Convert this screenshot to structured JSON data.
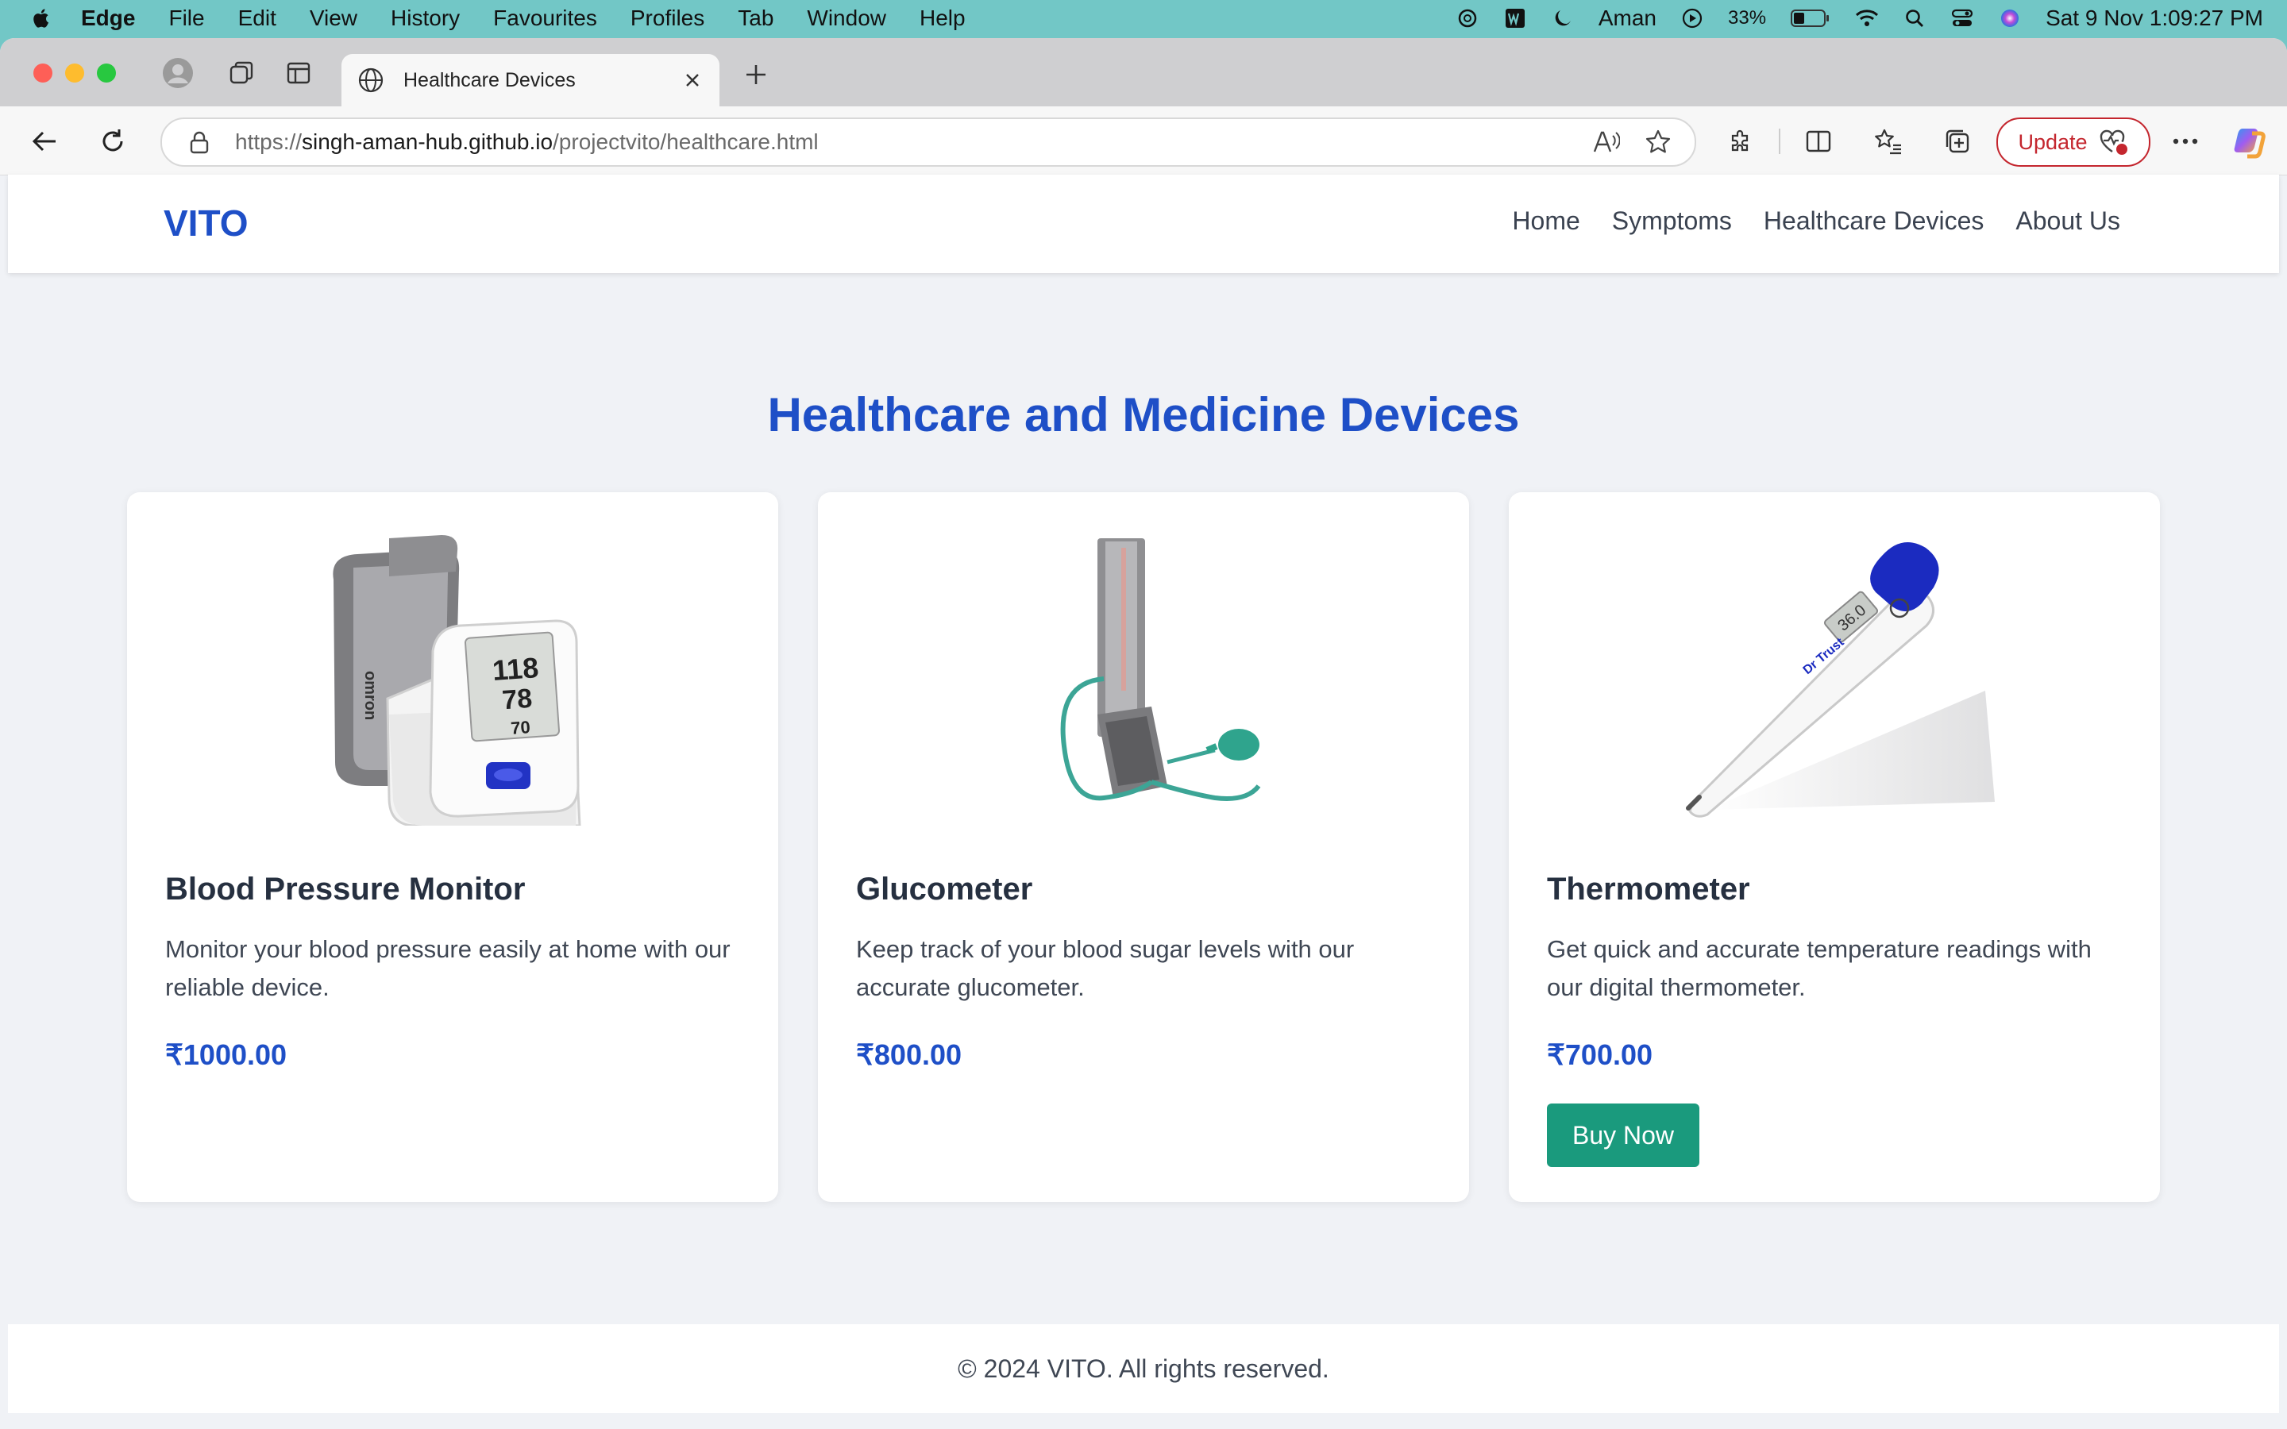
{
  "menubar": {
    "app": "Edge",
    "items": [
      "File",
      "Edit",
      "View",
      "History",
      "Favourites",
      "Profiles",
      "Tab",
      "Window",
      "Help"
    ],
    "user": "Aman",
    "battery": "33%",
    "datetime": "Sat 9 Nov  1:09:27 PM"
  },
  "browser": {
    "tab_title": "Healthcare Devices",
    "url_scheme": "https://",
    "url_host": "singh-aman-hub.github.io",
    "url_path": "/projectvito/healthcare.html",
    "update_label": "Update"
  },
  "site": {
    "brand": "VITO",
    "nav": [
      "Home",
      "Symptoms",
      "Healthcare Devices",
      "About Us"
    ],
    "heading": "Healthcare and Medicine Devices",
    "products": [
      {
        "name": "Blood Pressure Monitor",
        "description": "Monitor your blood pressure easily at home with our reliable device.",
        "price": "₹1000.00",
        "image": "blood-pressure-monitor-image",
        "screen_readings": [
          "118",
          "78",
          "70"
        ]
      },
      {
        "name": "Glucometer",
        "description": "Keep track of your blood sugar levels with our accurate glucometer.",
        "price": "₹800.00",
        "image": "glucometer-image"
      },
      {
        "name": "Thermometer",
        "description": "Get quick and accurate temperature readings with our digital thermometer.",
        "price": "₹700.00",
        "image": "thermometer-image",
        "display_reading": "36.0",
        "button": "Buy Now"
      }
    ],
    "footer": "© 2024 VITO. All rights reserved."
  },
  "colors": {
    "brand_blue": "#1e4fc7",
    "buy_button": "#1a9a7d",
    "menubar_bg": "#72c7c6"
  }
}
